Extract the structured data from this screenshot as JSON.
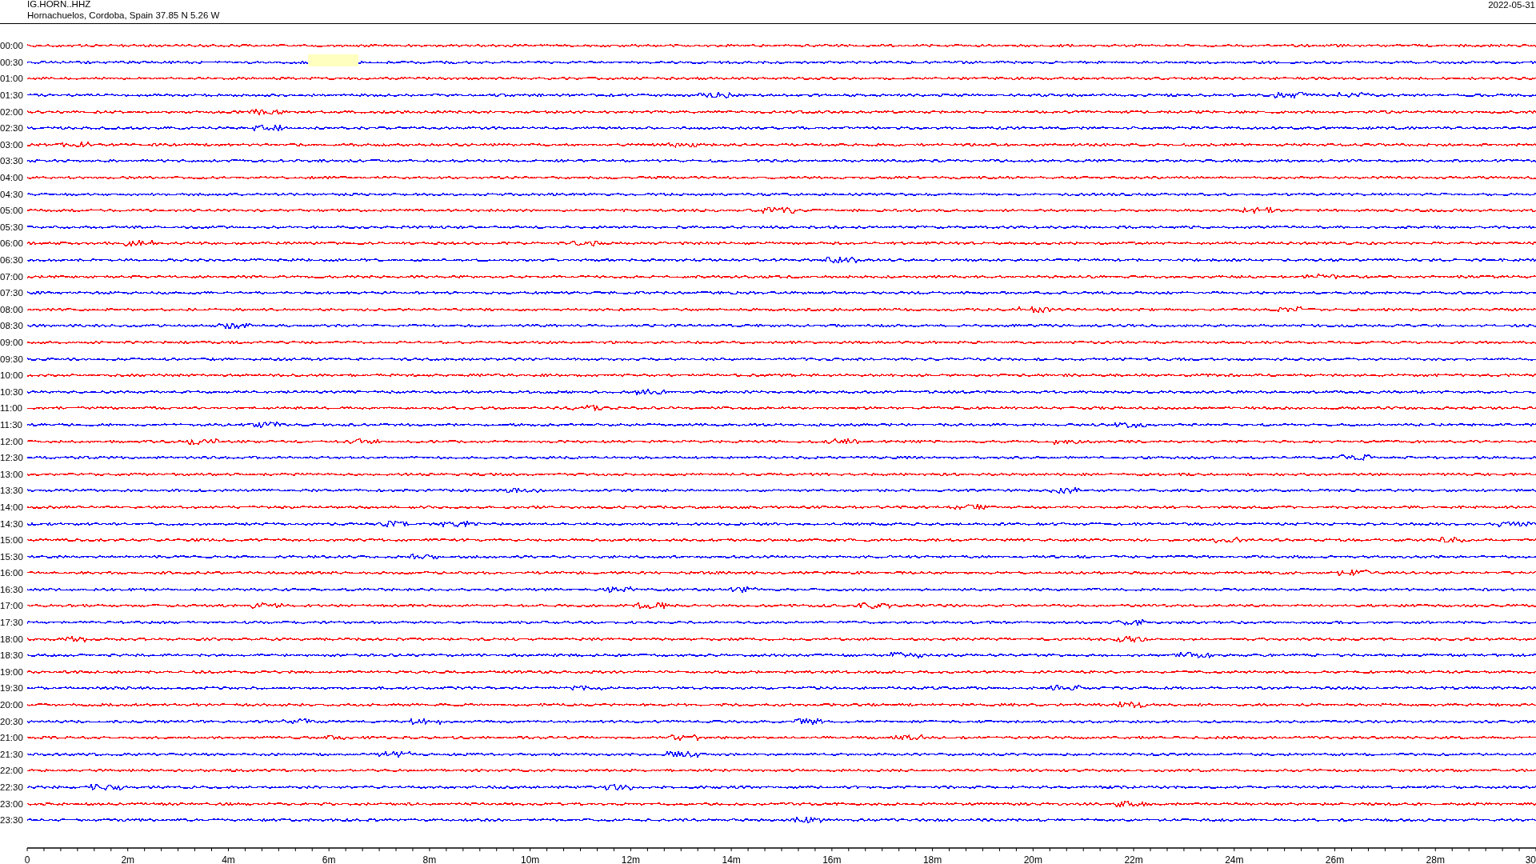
{
  "header": {
    "station": "IG.HORN..HHZ",
    "location": "Hornachuelos, Cordoba, Spain  37.85 N 5.26 W",
    "date": "2022-05-31"
  },
  "rows": [
    {
      "time": "00:00",
      "color": "#ff0000",
      "gap": false
    },
    {
      "time": "00:30",
      "color": "#0000ff",
      "gap": true
    },
    {
      "time": "01:00",
      "color": "#ff0000",
      "gap": false
    },
    {
      "time": "01:30",
      "color": "#0000ff",
      "gap": false
    },
    {
      "time": "02:00",
      "color": "#ff0000",
      "gap": false
    },
    {
      "time": "02:30",
      "color": "#0000ff",
      "gap": false
    },
    {
      "time": "03:00",
      "color": "#ff0000",
      "gap": false
    },
    {
      "time": "03:30",
      "color": "#0000ff",
      "gap": false
    },
    {
      "time": "04:00",
      "color": "#ff0000",
      "gap": false
    },
    {
      "time": "04:30",
      "color": "#0000ff",
      "gap": false
    },
    {
      "time": "05:00",
      "color": "#ff0000",
      "gap": false
    },
    {
      "time": "05:30",
      "color": "#0000ff",
      "gap": false
    },
    {
      "time": "06:00",
      "color": "#ff0000",
      "gap": false
    },
    {
      "time": "06:30",
      "color": "#0000ff",
      "gap": false
    },
    {
      "time": "07:00",
      "color": "#ff0000",
      "gap": false
    },
    {
      "time": "07:30",
      "color": "#0000ff",
      "gap": false
    },
    {
      "time": "08:00",
      "color": "#ff0000",
      "gap": false
    },
    {
      "time": "08:30",
      "color": "#0000ff",
      "gap": false
    },
    {
      "time": "09:00",
      "color": "#ff0000",
      "gap": false
    },
    {
      "time": "09:30",
      "color": "#0000ff",
      "gap": false
    },
    {
      "time": "10:00",
      "color": "#ff0000",
      "gap": false
    },
    {
      "time": "10:30",
      "color": "#0000ff",
      "gap": false
    },
    {
      "time": "11:00",
      "color": "#ff0000",
      "gap": false
    },
    {
      "time": "11:30",
      "color": "#0000ff",
      "gap": false
    },
    {
      "time": "12:00",
      "color": "#ff0000",
      "gap": false
    },
    {
      "time": "12:30",
      "color": "#0000ff",
      "gap": false
    },
    {
      "time": "13:00",
      "color": "#ff0000",
      "gap": false
    },
    {
      "time": "13:30",
      "color": "#0000ff",
      "gap": false
    },
    {
      "time": "14:00",
      "color": "#ff0000",
      "gap": false
    },
    {
      "time": "14:30",
      "color": "#0000ff",
      "gap": false
    },
    {
      "time": "15:00",
      "color": "#ff0000",
      "gap": false
    },
    {
      "time": "15:30",
      "color": "#0000ff",
      "gap": false
    },
    {
      "time": "16:00",
      "color": "#ff0000",
      "gap": false
    },
    {
      "time": "16:30",
      "color": "#0000ff",
      "gap": false
    },
    {
      "time": "17:00",
      "color": "#ff0000",
      "gap": false
    },
    {
      "time": "17:30",
      "color": "#0000ff",
      "gap": false
    },
    {
      "time": "18:00",
      "color": "#ff0000",
      "gap": false
    },
    {
      "time": "18:30",
      "color": "#0000ff",
      "gap": false
    },
    {
      "time": "19:00",
      "color": "#ff0000",
      "gap": false
    },
    {
      "time": "19:30",
      "color": "#0000ff",
      "gap": false
    },
    {
      "time": "20:00",
      "color": "#ff0000",
      "gap": false
    },
    {
      "time": "20:30",
      "color": "#0000ff",
      "gap": false
    },
    {
      "time": "21:00",
      "color": "#ff0000",
      "gap": false
    },
    {
      "time": "21:30",
      "color": "#0000ff",
      "gap": false
    },
    {
      "time": "22:00",
      "color": "#ff0000",
      "gap": false
    },
    {
      "time": "22:30",
      "color": "#0000ff",
      "gap": false
    },
    {
      "time": "23:00",
      "color": "#ff0000",
      "gap": false
    },
    {
      "time": "23:30",
      "color": "#0000ff",
      "gap": false
    }
  ],
  "axis": {
    "labels": [
      "0",
      "2m",
      "4m",
      "6m",
      "8m",
      "10m",
      "12m",
      "14m",
      "16m",
      "18m",
      "20m",
      "22m",
      "24m",
      "26m",
      "28m",
      "30"
    ]
  }
}
